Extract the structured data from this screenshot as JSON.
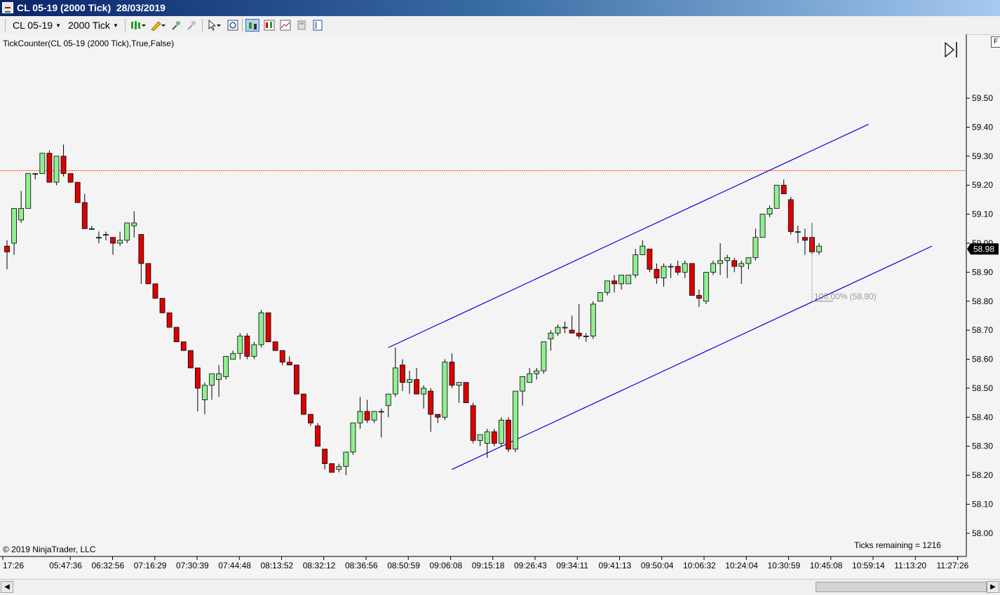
{
  "window": {
    "title": "CL 05-19 (2000 Tick)  28/03/2019"
  },
  "toolbar": {
    "instrument": "CL 05-19",
    "interval": "2000 Tick",
    "icons": [
      "bars-style-icon",
      "pencil-draw-icon",
      "zoom-in-icon",
      "zoom-out-icon",
      "cursor-icon",
      "search-properties-icon",
      "candlestick-icon",
      "bar-chart-icon",
      "line-chart-icon",
      "data-box-icon",
      "panel-icon"
    ]
  },
  "indicator_label": "TickCounter(CL  05-19  (2000  Tick),True,False)",
  "copyright": "© 2019 NinjaTrader, LLC",
  "ticks_remaining": "Ticks remaining = 1216",
  "right_strip_label": "F",
  "colors": {
    "up": "#90ee90",
    "down": "#dd0000",
    "channel": "#0000dd",
    "priceline": "#ff4500",
    "background": "#f4f4f4"
  },
  "chart_data": {
    "type": "candlestick",
    "instrument": "CL 05-19",
    "interval": "2000 Tick",
    "ylim": [
      57.92,
      59.72
    ],
    "yticks": [
      58.0,
      58.1,
      58.2,
      58.3,
      58.4,
      58.5,
      58.6,
      58.7,
      58.8,
      58.9,
      59.0,
      59.1,
      59.2,
      59.3,
      59.4,
      59.5
    ],
    "ytick_labels": [
      "58.00",
      "58.10",
      "58.20",
      "58.30",
      "58.40",
      "58.50",
      "58.60",
      "58.70",
      "58.80",
      "58.90",
      "59.00",
      "59.10",
      "59.20",
      "59.30",
      "59.40",
      "59.50"
    ],
    "xtick_labels": [
      "17:26",
      "05:47:36",
      "06:32:56",
      "07:16:29",
      "07:30:39",
      "07:44:48",
      "08:13:52",
      "08:32:12",
      "08:36:56",
      "08:50:59",
      "09:06:08",
      "09:15:18",
      "09:26:43",
      "09:34:11",
      "09:41:13",
      "09:50:04",
      "10:06:32",
      "10:24:04",
      "10:30:59",
      "10:45:08",
      "10:59:14",
      "11:13:20",
      "11:27:26"
    ],
    "last_price": 58.98,
    "last_price_label": "58.98",
    "horizontal_line": 59.25,
    "fib_label": "100.00% (58.80)",
    "fib_level": 58.8,
    "channel": [
      {
        "from": [
          54,
          58.64
        ],
        "to": [
          122,
          59.41
        ]
      },
      {
        "from": [
          63,
          58.22
        ],
        "to": [
          131,
          58.99
        ]
      }
    ],
    "candles": [
      [
        58.99,
        59.01,
        58.91,
        58.97
      ],
      [
        59.0,
        59.12,
        58.96,
        59.12
      ],
      [
        59.08,
        59.18,
        59.07,
        59.12
      ],
      [
        59.12,
        59.24,
        59.12,
        59.24
      ],
      [
        59.24,
        59.24,
        59.22,
        59.24
      ],
      [
        59.24,
        59.31,
        59.24,
        59.31
      ],
      [
        59.31,
        59.32,
        59.21,
        59.21
      ],
      [
        59.21,
        59.3,
        59.2,
        59.3
      ],
      [
        59.3,
        59.34,
        59.23,
        59.24
      ],
      [
        59.24,
        59.24,
        59.21,
        59.21
      ],
      [
        59.21,
        59.21,
        59.14,
        59.14
      ],
      [
        59.14,
        59.17,
        59.05,
        59.05
      ],
      [
        59.05,
        59.06,
        59.05,
        59.05
      ],
      [
        59.02,
        59.04,
        59.0,
        59.02
      ],
      [
        59.03,
        59.04,
        59.01,
        59.03
      ],
      [
        59.02,
        59.02,
        58.96,
        59.0
      ],
      [
        59.0,
        59.04,
        58.99,
        59.01
      ],
      [
        59.01,
        59.07,
        59.0,
        59.07
      ],
      [
        59.06,
        59.11,
        59.02,
        59.07
      ],
      [
        59.03,
        59.03,
        58.86,
        58.93
      ],
      [
        58.93,
        58.93,
        58.86,
        58.86
      ],
      [
        58.86,
        58.86,
        58.81,
        58.81
      ],
      [
        58.81,
        58.81,
        58.76,
        58.76
      ],
      [
        58.76,
        58.76,
        58.71,
        58.71
      ],
      [
        58.71,
        58.71,
        58.66,
        58.66
      ],
      [
        58.66,
        58.66,
        58.63,
        58.63
      ],
      [
        58.63,
        58.63,
        58.57,
        58.57
      ],
      [
        58.57,
        58.57,
        58.42,
        58.5
      ],
      [
        58.46,
        58.52,
        58.41,
        58.51
      ],
      [
        58.51,
        58.55,
        58.46,
        58.55
      ],
      [
        58.53,
        58.58,
        58.47,
        58.55
      ],
      [
        58.54,
        58.6,
        58.53,
        58.61
      ],
      [
        58.6,
        58.63,
        58.6,
        58.62
      ],
      [
        58.62,
        58.69,
        58.6,
        58.68
      ],
      [
        58.68,
        58.69,
        58.6,
        58.61
      ],
      [
        58.61,
        58.66,
        58.6,
        58.65
      ],
      [
        58.65,
        58.77,
        58.64,
        58.76
      ],
      [
        58.76,
        58.76,
        58.66,
        58.66
      ],
      [
        58.66,
        58.66,
        58.63,
        58.63
      ],
      [
        58.63,
        58.63,
        58.58,
        58.59
      ],
      [
        58.59,
        58.61,
        58.58,
        58.58
      ],
      [
        58.58,
        58.58,
        58.48,
        58.48
      ],
      [
        58.48,
        58.48,
        58.41,
        58.41
      ],
      [
        58.41,
        58.41,
        58.37,
        58.38
      ],
      [
        58.37,
        58.38,
        58.3,
        58.3
      ],
      [
        58.29,
        58.28,
        58.22,
        58.24
      ],
      [
        58.24,
        58.24,
        58.21,
        58.21
      ],
      [
        58.22,
        58.24,
        58.21,
        58.23
      ],
      [
        58.23,
        58.28,
        58.2,
        58.28
      ],
      [
        58.28,
        58.38,
        58.27,
        58.38
      ],
      [
        58.38,
        58.47,
        58.36,
        58.42
      ],
      [
        58.42,
        58.46,
        58.38,
        58.39
      ],
      [
        58.39,
        58.41,
        58.38,
        58.42
      ],
      [
        58.42,
        58.43,
        58.33,
        58.42
      ],
      [
        58.44,
        58.48,
        58.4,
        58.48
      ],
      [
        58.48,
        58.64,
        58.47,
        58.57
      ],
      [
        58.58,
        58.6,
        58.49,
        58.52
      ],
      [
        58.52,
        58.56,
        58.48,
        58.53
      ],
      [
        58.53,
        58.57,
        58.48,
        58.48
      ],
      [
        58.48,
        58.51,
        58.43,
        58.5
      ],
      [
        58.49,
        58.5,
        58.35,
        58.41
      ],
      [
        58.41,
        58.41,
        58.38,
        58.4
      ],
      [
        58.4,
        58.6,
        58.39,
        58.59
      ],
      [
        58.59,
        58.62,
        58.5,
        58.51
      ],
      [
        58.51,
        58.51,
        58.45,
        58.52
      ],
      [
        58.52,
        58.52,
        58.45,
        58.45
      ],
      [
        58.44,
        58.45,
        58.31,
        58.32
      ],
      [
        58.32,
        58.34,
        58.3,
        58.34
      ],
      [
        58.31,
        58.36,
        58.26,
        58.35
      ],
      [
        58.35,
        58.36,
        58.3,
        58.31
      ],
      [
        58.31,
        58.4,
        58.3,
        58.39
      ],
      [
        58.39,
        58.4,
        58.28,
        58.29
      ],
      [
        58.29,
        58.49,
        58.28,
        58.49
      ],
      [
        58.49,
        58.5,
        58.44,
        58.54
      ],
      [
        58.52,
        58.57,
        58.52,
        58.55
      ],
      [
        58.55,
        58.57,
        58.53,
        58.56
      ],
      [
        58.56,
        58.66,
        58.55,
        58.66
      ],
      [
        58.67,
        58.7,
        58.63,
        58.69
      ],
      [
        58.69,
        58.72,
        58.68,
        58.71
      ],
      [
        58.71,
        58.73,
        58.69,
        58.71
      ],
      [
        58.7,
        58.75,
        58.69,
        58.69
      ],
      [
        58.69,
        58.79,
        58.67,
        58.68
      ],
      [
        58.68,
        58.69,
        58.66,
        58.68
      ],
      [
        58.68,
        58.8,
        58.67,
        58.79
      ],
      [
        58.8,
        58.83,
        58.8,
        58.83
      ],
      [
        58.83,
        58.87,
        58.82,
        58.87
      ],
      [
        58.87,
        58.89,
        58.83,
        58.86
      ],
      [
        58.86,
        58.89,
        58.84,
        58.89
      ],
      [
        58.86,
        58.88,
        58.86,
        58.89
      ],
      [
        58.89,
        58.98,
        58.88,
        58.96
      ],
      [
        58.96,
        59.01,
        58.96,
        58.99
      ],
      [
        58.98,
        58.98,
        58.9,
        58.91
      ],
      [
        58.91,
        58.93,
        58.86,
        58.88
      ],
      [
        58.88,
        58.93,
        58.85,
        58.92
      ],
      [
        58.92,
        58.93,
        58.88,
        58.92
      ],
      [
        58.92,
        58.94,
        58.89,
        58.9
      ],
      [
        58.9,
        58.94,
        58.88,
        58.93
      ],
      [
        58.93,
        58.93,
        58.84,
        58.82
      ],
      [
        58.82,
        58.84,
        58.78,
        58.81
      ],
      [
        58.8,
        58.9,
        58.79,
        58.9
      ],
      [
        58.9,
        58.94,
        58.89,
        58.93
      ],
      [
        58.93,
        59.0,
        58.89,
        58.94
      ],
      [
        58.94,
        58.96,
        58.88,
        58.95
      ],
      [
        58.94,
        58.95,
        58.9,
        58.92
      ],
      [
        58.92,
        58.94,
        58.86,
        58.93
      ],
      [
        58.93,
        58.95,
        58.91,
        58.95
      ],
      [
        58.95,
        59.05,
        58.94,
        59.02
      ],
      [
        59.02,
        59.1,
        59.02,
        59.1
      ],
      [
        59.1,
        59.13,
        59.09,
        59.12
      ],
      [
        59.12,
        59.2,
        59.12,
        59.2
      ],
      [
        59.2,
        59.22,
        59.17,
        59.17
      ],
      [
        59.15,
        59.16,
        59.03,
        59.04
      ],
      [
        59.04,
        59.06,
        59.0,
        59.04
      ],
      [
        59.02,
        59.05,
        58.96,
        59.01
      ],
      [
        59.02,
        59.07,
        58.96,
        58.97
      ],
      [
        58.97,
        59.0,
        58.96,
        58.99
      ]
    ]
  }
}
